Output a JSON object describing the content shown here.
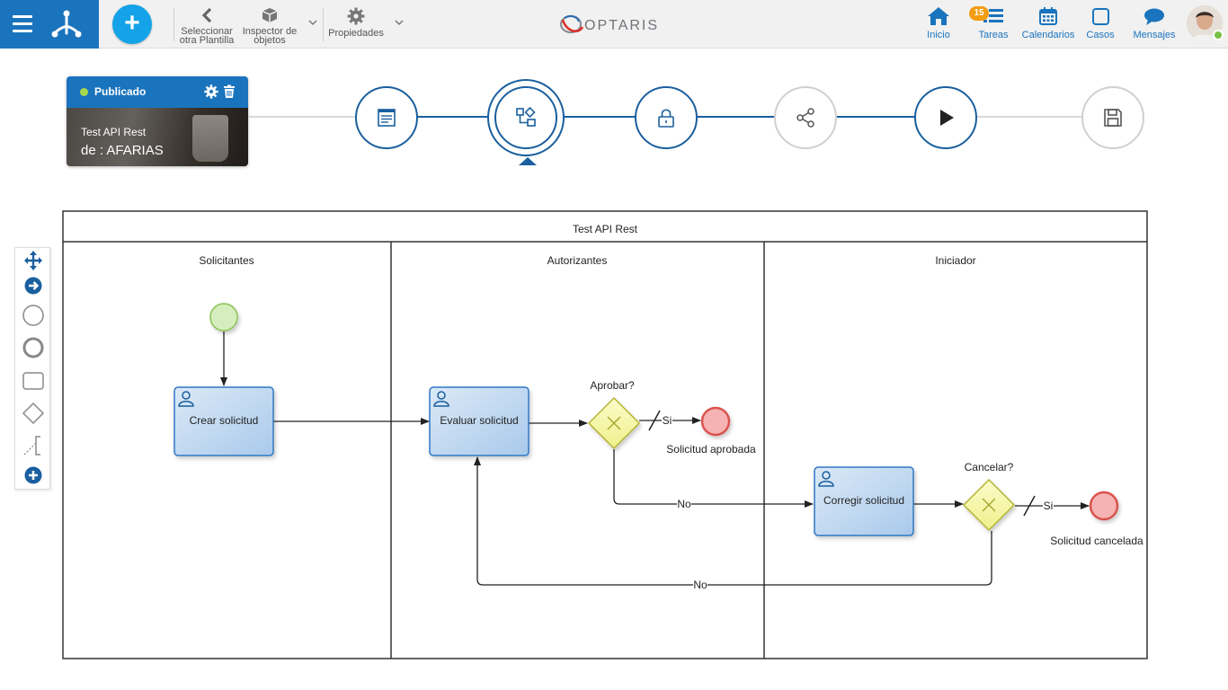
{
  "topbar": {
    "tools": {
      "select_template": "Seleccionar otra Plantilla",
      "select_template_line1": "Seleccionar",
      "select_template_line2": "otra Plantilla",
      "object_inspector_line1": "Inspector de",
      "object_inspector_line2": "objetos",
      "properties": "Propiedades"
    },
    "brand": "OPTARIS",
    "nav": {
      "home": "Inicio",
      "tasks": "Tareas",
      "tasks_badge": "15",
      "calendars": "Calendarios",
      "cases": "Casos",
      "messages": "Mensajes"
    }
  },
  "template_card": {
    "status": "Publicado",
    "name": "Test API Rest",
    "owner": "de : AFARIAS",
    "status_color": "#a7d84b"
  },
  "steps": {
    "icons": [
      "form-icon",
      "diagram-icon",
      "lock-icon",
      "share-icon",
      "play-icon",
      "save-icon"
    ],
    "active_index": 1
  },
  "palette": {
    "icons": [
      "move-icon",
      "arrow-right-circle-icon",
      "start-event-icon",
      "intermediate-event-icon",
      "task-icon",
      "gateway-icon",
      "connector-icon",
      "add-icon"
    ]
  },
  "diagram": {
    "pool": "Test API Rest",
    "lanes": [
      "Solicitantes",
      "Autorizantes",
      "Iniciador"
    ],
    "tasks": {
      "create": "Crear solicitud",
      "evaluate": "Evaluar solicitud",
      "correct": "Corregir solicitud"
    },
    "gateways": {
      "approve": "Aprobar?",
      "cancel": "Cancelar?"
    },
    "events": {
      "approved": "Solicitud aprobada",
      "cancelled": "Solicitud cancelada"
    },
    "flows": {
      "yes1": "Si",
      "no1": "No",
      "yes2": "Si",
      "no2": "No"
    },
    "colors": {
      "primary": "#1a74bd",
      "task_fill": "#c5dcf2",
      "gateway_fill": "#f5f6a8",
      "start_fill": "#d6eebd",
      "end_fill": "#f6b3b3"
    }
  }
}
